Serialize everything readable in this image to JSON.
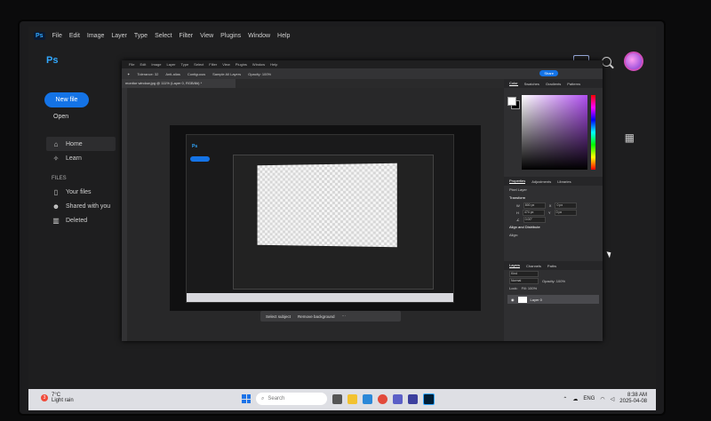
{
  "home": {
    "menu": [
      "File",
      "Edit",
      "Image",
      "Layer",
      "Type",
      "Select",
      "Filter",
      "View",
      "Plugins",
      "Window",
      "Help"
    ],
    "app_badge": "Ps",
    "logo": "Ps",
    "new_file": "New file",
    "open": "Open",
    "nav": [
      {
        "label": "Home",
        "icon": "home-icon"
      },
      {
        "label": "Learn",
        "icon": "bulb-icon"
      }
    ],
    "files_heading": "FILES",
    "files_nav": [
      {
        "label": "Your files",
        "icon": "file-icon"
      },
      {
        "label": "Shared with you",
        "icon": "people-icon"
      },
      {
        "label": "Deleted",
        "icon": "trash-icon"
      }
    ]
  },
  "taskbar": {
    "temp": "7°C",
    "weather": "Light rain",
    "notification_count": "3",
    "search_placeholder": "Search",
    "lang": "ENG",
    "time": "8:38 AM",
    "date": "2025-04-08"
  },
  "ps": {
    "menu": [
      "File",
      "Edit",
      "Image",
      "Layer",
      "Type",
      "Select",
      "Filter",
      "View",
      "Plugins",
      "Window",
      "Help"
    ],
    "options": [
      "Tolerance: 32",
      "Anti-alias",
      "Contiguous",
      "Sample All Layers",
      "Opacity: 100%"
    ],
    "share": "Share",
    "doc_tab": "monitor window.jpg @ 111% (Layer 0, RGB/8#) *",
    "color_tabs": [
      "Color",
      "Swatches",
      "Gradients",
      "Patterns"
    ],
    "prop_tabs": [
      "Properties",
      "Adjustments",
      "Libraries"
    ],
    "pixel_layer": "Pixel Layer",
    "transform": "Transform",
    "w": "800 px",
    "h": "474 px",
    "x": "0 px",
    "y": "0 px",
    "angle": "0.00°",
    "align": "Align and Distribute",
    "align_sub": "Align:",
    "layer_tabs": [
      "Layers",
      "Channels",
      "Paths"
    ],
    "kind": "Kind",
    "blend": "Normal",
    "opacity": "Opacity: 100%",
    "lock": "Lock:",
    "fill": "Fill: 100%",
    "layer_name": "Layer 0",
    "select_subject": "Select subject",
    "remove_background": "Remove background"
  }
}
